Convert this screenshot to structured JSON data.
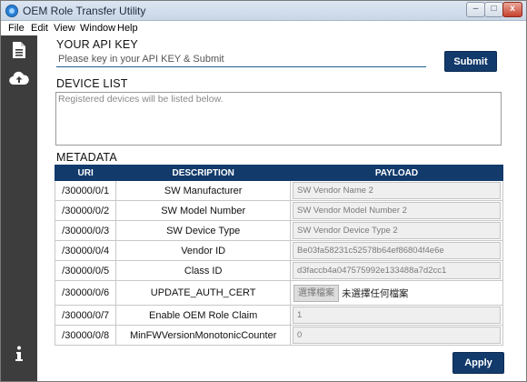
{
  "window": {
    "title": "OEM Role Transfer Utility",
    "controls": {
      "minimize": "–",
      "maximize": "□",
      "close": "x"
    }
  },
  "menu": [
    "File",
    "Edit",
    "View",
    "Window",
    "Help"
  ],
  "sidebar": {
    "items": [
      {
        "icon": "document-icon"
      },
      {
        "icon": "cloud-upload-icon"
      },
      {
        "icon": "info-icon"
      }
    ]
  },
  "api_key": {
    "heading": "YOUR API KEY",
    "placeholder": "Please key in your API KEY & Submit",
    "value": "",
    "submit_label": "Submit"
  },
  "device_list": {
    "heading": "DEVICE LIST",
    "placeholder": "Registered devices will be listed below."
  },
  "metadata": {
    "heading": "METADATA",
    "columns": [
      "URI",
      "DESCRIPTION",
      "PAYLOAD"
    ],
    "rows": [
      {
        "uri": "/30000/0/1",
        "description": "SW Manufacturer",
        "payload": "SW Vendor Name 2"
      },
      {
        "uri": "/30000/0/2",
        "description": "SW Model Number",
        "payload": "SW Vendor Model Number 2"
      },
      {
        "uri": "/30000/0/3",
        "description": "SW Device Type",
        "payload": "SW Vendor Device Type 2"
      },
      {
        "uri": "/30000/0/4",
        "description": "Vendor ID",
        "payload": "Be03fa58231c52578b64ef86804f4e6e"
      },
      {
        "uri": "/30000/0/5",
        "description": "Class ID",
        "payload": "d3faccb4a047575992e133488a7d2cc1"
      },
      {
        "uri": "/30000/0/6",
        "description": "UPDATE_AUTH_CERT",
        "file_button": "選擇檔案",
        "file_status": "未選擇任何檔案"
      },
      {
        "uri": "/30000/0/7",
        "description": "Enable OEM Role Claim",
        "payload": "1"
      },
      {
        "uri": "/30000/0/8",
        "description": "MinFWVersionMonotonicCounter",
        "payload": "0"
      }
    ]
  },
  "apply_label": "Apply",
  "colors": {
    "accent": "#123a6b",
    "sidebar": "#3d3d3d"
  }
}
